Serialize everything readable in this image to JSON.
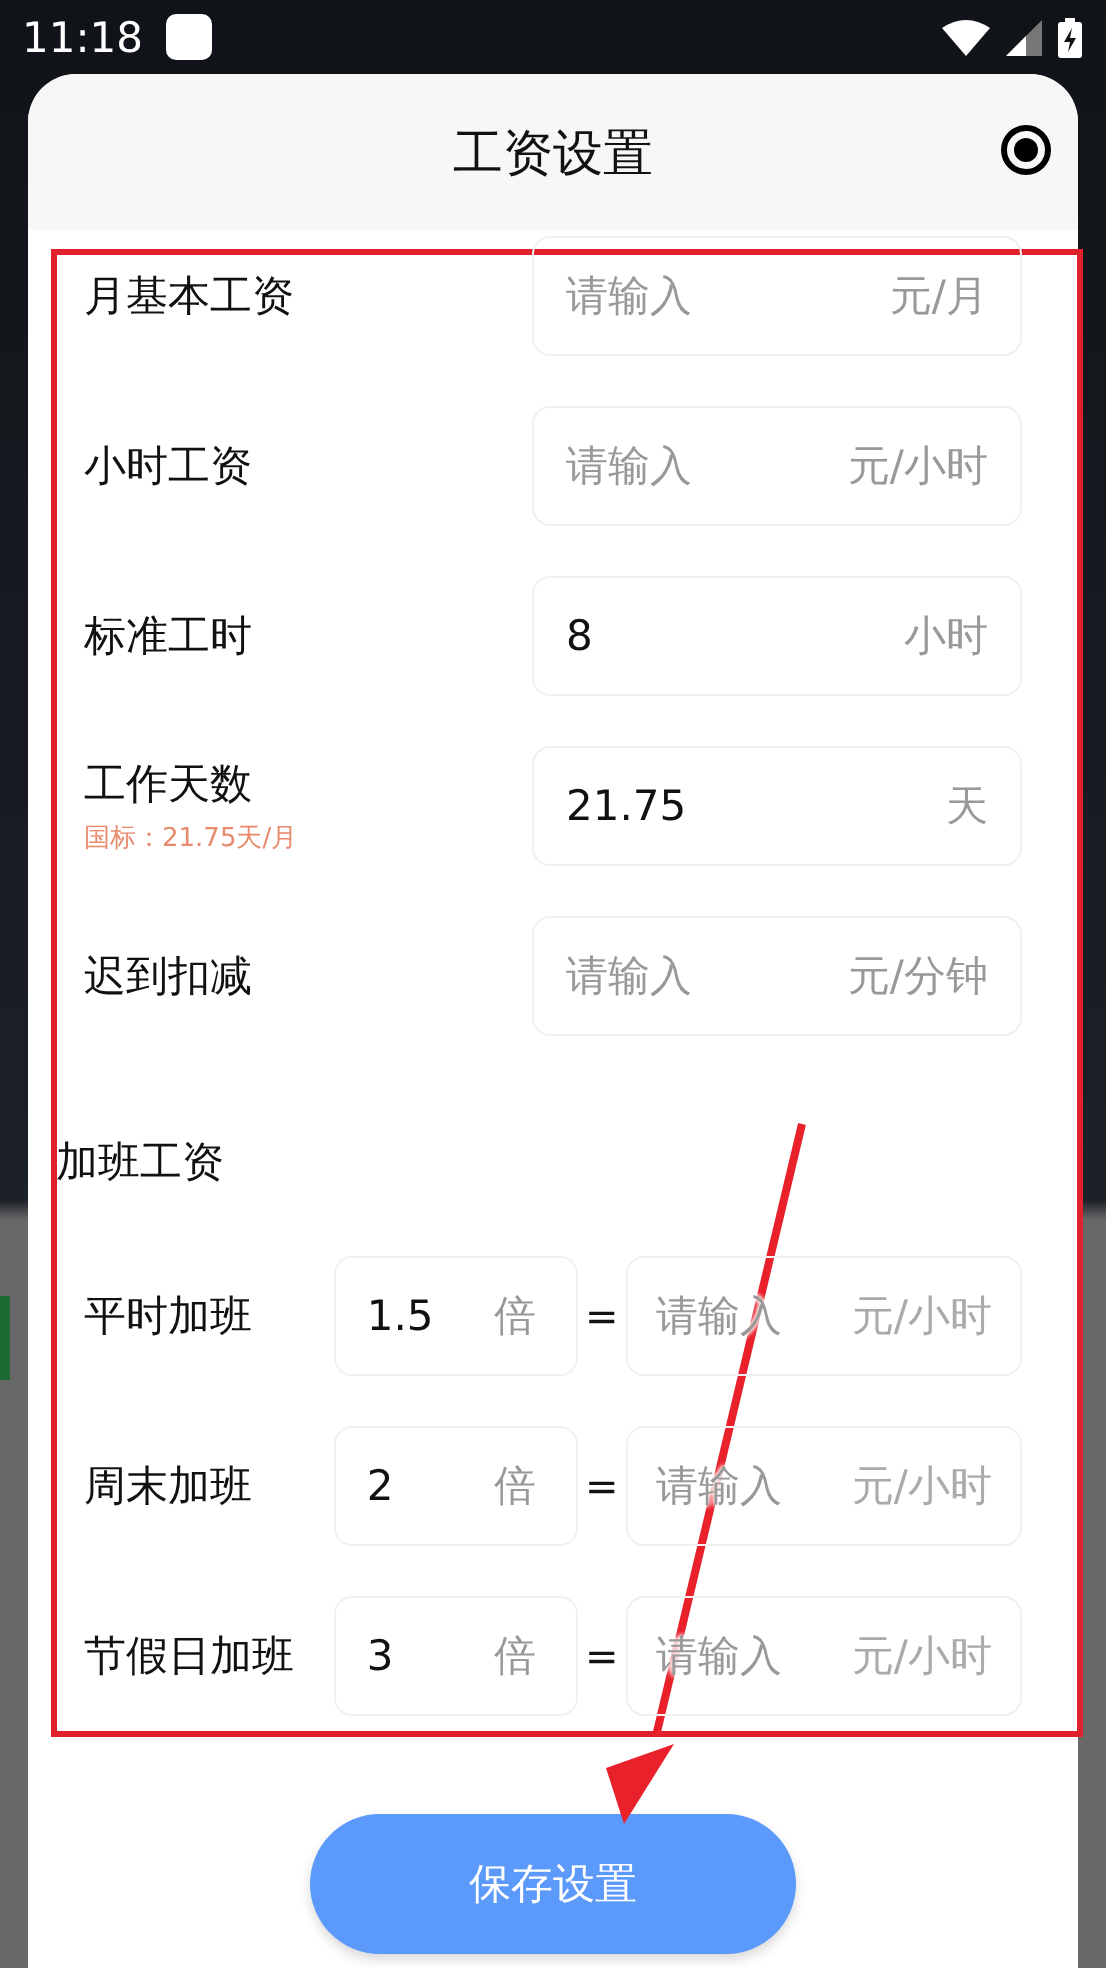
{
  "status_bar": {
    "time": "11:18"
  },
  "dialog": {
    "title": "工资设置"
  },
  "fields": [
    {
      "label": "月基本工资",
      "input": {
        "placeholder": "请输入",
        "unit": "元/月"
      }
    },
    {
      "label": "小时工资",
      "input": {
        "placeholder": "请输入",
        "unit": "元/小时"
      }
    },
    {
      "label": "标准工时",
      "input": {
        "value": "8",
        "unit": "小时"
      }
    },
    {
      "label": "工作天数",
      "note": "国标：21.75天/月",
      "input": {
        "value": "21.75",
        "unit": "天"
      }
    },
    {
      "label": "迟到扣减",
      "input": {
        "placeholder": "请输入",
        "unit": "元/分钟"
      }
    }
  ],
  "overtime": {
    "title": "加班工资",
    "rows": [
      {
        "label": "平时加班",
        "multiplier": {
          "value": "1.5",
          "unit": "倍"
        },
        "equals": "=",
        "result": {
          "placeholder": "请输入",
          "unit": "元/小时"
        }
      },
      {
        "label": "周末加班",
        "multiplier": {
          "value": "2",
          "unit": "倍"
        },
        "equals": "=",
        "result": {
          "placeholder": "请输入",
          "unit": "元/小时"
        }
      },
      {
        "label": "节假日加班",
        "multiplier": {
          "value": "3",
          "unit": "倍"
        },
        "equals": "=",
        "result": {
          "placeholder": "请输入",
          "unit": "元/小时"
        }
      }
    ]
  },
  "save_button": "保存设置"
}
